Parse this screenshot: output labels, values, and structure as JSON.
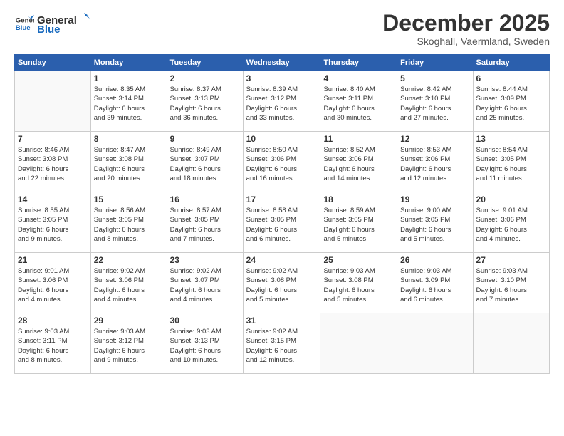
{
  "header": {
    "logo_line1": "General",
    "logo_line2": "Blue",
    "month": "December 2025",
    "location": "Skoghall, Vaermland, Sweden"
  },
  "weekdays": [
    "Sunday",
    "Monday",
    "Tuesday",
    "Wednesday",
    "Thursday",
    "Friday",
    "Saturday"
  ],
  "weeks": [
    [
      {
        "day": "",
        "info": ""
      },
      {
        "day": "1",
        "info": "Sunrise: 8:35 AM\nSunset: 3:14 PM\nDaylight: 6 hours\nand 39 minutes."
      },
      {
        "day": "2",
        "info": "Sunrise: 8:37 AM\nSunset: 3:13 PM\nDaylight: 6 hours\nand 36 minutes."
      },
      {
        "day": "3",
        "info": "Sunrise: 8:39 AM\nSunset: 3:12 PM\nDaylight: 6 hours\nand 33 minutes."
      },
      {
        "day": "4",
        "info": "Sunrise: 8:40 AM\nSunset: 3:11 PM\nDaylight: 6 hours\nand 30 minutes."
      },
      {
        "day": "5",
        "info": "Sunrise: 8:42 AM\nSunset: 3:10 PM\nDaylight: 6 hours\nand 27 minutes."
      },
      {
        "day": "6",
        "info": "Sunrise: 8:44 AM\nSunset: 3:09 PM\nDaylight: 6 hours\nand 25 minutes."
      }
    ],
    [
      {
        "day": "7",
        "info": "Sunrise: 8:46 AM\nSunset: 3:08 PM\nDaylight: 6 hours\nand 22 minutes."
      },
      {
        "day": "8",
        "info": "Sunrise: 8:47 AM\nSunset: 3:08 PM\nDaylight: 6 hours\nand 20 minutes."
      },
      {
        "day": "9",
        "info": "Sunrise: 8:49 AM\nSunset: 3:07 PM\nDaylight: 6 hours\nand 18 minutes."
      },
      {
        "day": "10",
        "info": "Sunrise: 8:50 AM\nSunset: 3:06 PM\nDaylight: 6 hours\nand 16 minutes."
      },
      {
        "day": "11",
        "info": "Sunrise: 8:52 AM\nSunset: 3:06 PM\nDaylight: 6 hours\nand 14 minutes."
      },
      {
        "day": "12",
        "info": "Sunrise: 8:53 AM\nSunset: 3:06 PM\nDaylight: 6 hours\nand 12 minutes."
      },
      {
        "day": "13",
        "info": "Sunrise: 8:54 AM\nSunset: 3:05 PM\nDaylight: 6 hours\nand 11 minutes."
      }
    ],
    [
      {
        "day": "14",
        "info": "Sunrise: 8:55 AM\nSunset: 3:05 PM\nDaylight: 6 hours\nand 9 minutes."
      },
      {
        "day": "15",
        "info": "Sunrise: 8:56 AM\nSunset: 3:05 PM\nDaylight: 6 hours\nand 8 minutes."
      },
      {
        "day": "16",
        "info": "Sunrise: 8:57 AM\nSunset: 3:05 PM\nDaylight: 6 hours\nand 7 minutes."
      },
      {
        "day": "17",
        "info": "Sunrise: 8:58 AM\nSunset: 3:05 PM\nDaylight: 6 hours\nand 6 minutes."
      },
      {
        "day": "18",
        "info": "Sunrise: 8:59 AM\nSunset: 3:05 PM\nDaylight: 6 hours\nand 5 minutes."
      },
      {
        "day": "19",
        "info": "Sunrise: 9:00 AM\nSunset: 3:05 PM\nDaylight: 6 hours\nand 5 minutes."
      },
      {
        "day": "20",
        "info": "Sunrise: 9:01 AM\nSunset: 3:06 PM\nDaylight: 6 hours\nand 4 minutes."
      }
    ],
    [
      {
        "day": "21",
        "info": "Sunrise: 9:01 AM\nSunset: 3:06 PM\nDaylight: 6 hours\nand 4 minutes."
      },
      {
        "day": "22",
        "info": "Sunrise: 9:02 AM\nSunset: 3:06 PM\nDaylight: 6 hours\nand 4 minutes."
      },
      {
        "day": "23",
        "info": "Sunrise: 9:02 AM\nSunset: 3:07 PM\nDaylight: 6 hours\nand 4 minutes."
      },
      {
        "day": "24",
        "info": "Sunrise: 9:02 AM\nSunset: 3:08 PM\nDaylight: 6 hours\nand 5 minutes."
      },
      {
        "day": "25",
        "info": "Sunrise: 9:03 AM\nSunset: 3:08 PM\nDaylight: 6 hours\nand 5 minutes."
      },
      {
        "day": "26",
        "info": "Sunrise: 9:03 AM\nSunset: 3:09 PM\nDaylight: 6 hours\nand 6 minutes."
      },
      {
        "day": "27",
        "info": "Sunrise: 9:03 AM\nSunset: 3:10 PM\nDaylight: 6 hours\nand 7 minutes."
      }
    ],
    [
      {
        "day": "28",
        "info": "Sunrise: 9:03 AM\nSunset: 3:11 PM\nDaylight: 6 hours\nand 8 minutes."
      },
      {
        "day": "29",
        "info": "Sunrise: 9:03 AM\nSunset: 3:12 PM\nDaylight: 6 hours\nand 9 minutes."
      },
      {
        "day": "30",
        "info": "Sunrise: 9:03 AM\nSunset: 3:13 PM\nDaylight: 6 hours\nand 10 minutes."
      },
      {
        "day": "31",
        "info": "Sunrise: 9:02 AM\nSunset: 3:15 PM\nDaylight: 6 hours\nand 12 minutes."
      },
      {
        "day": "",
        "info": ""
      },
      {
        "day": "",
        "info": ""
      },
      {
        "day": "",
        "info": ""
      }
    ]
  ]
}
